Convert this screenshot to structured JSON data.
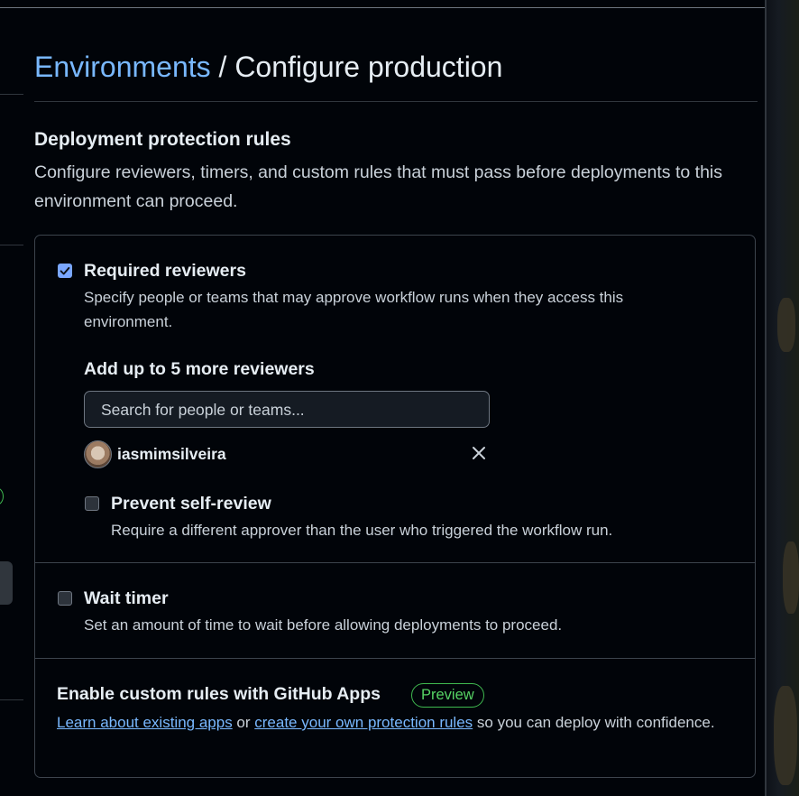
{
  "breadcrumb": {
    "link": "Environments",
    "separator": " / ",
    "current": "Configure production"
  },
  "protection": {
    "heading": "Deployment protection rules",
    "description": "Configure reviewers, timers, and custom rules that must pass before deployments to this environment can proceed."
  },
  "required_reviewers": {
    "checked": true,
    "title": "Required reviewers",
    "description": "Specify people or teams that may approve workflow runs when they access this environment.",
    "add_heading": "Add up to 5 more reviewers",
    "search_placeholder": "Search for people or teams...",
    "reviewers": [
      {
        "name": "iasmimsilveira"
      }
    ],
    "self_review": {
      "checked": false,
      "title": "Prevent self-review",
      "description": "Require a different approver than the user who triggered the workflow run."
    }
  },
  "wait_timer": {
    "checked": false,
    "title": "Wait timer",
    "description": "Set an amount of time to wait before allowing deployments to proceed."
  },
  "custom_rules": {
    "title": "Enable custom rules with GitHub Apps",
    "badge": "Preview",
    "link1": "Learn about existing apps",
    "middle": " or ",
    "link2": "create your own protection rules",
    "tail": " so you can deploy with confidence."
  },
  "colors": {
    "accent": "#79b8ff",
    "success": "#3fb950",
    "background": "#010409",
    "border": "#3d444d"
  }
}
